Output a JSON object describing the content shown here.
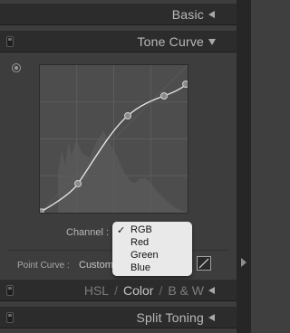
{
  "panels": {
    "basic": {
      "title": "Basic"
    },
    "tone_curve": {
      "title": "Tone Curve"
    },
    "hsl": {
      "hsl": "HSL",
      "color": "Color",
      "bw": "B & W",
      "sep": "/"
    },
    "split_toning": {
      "title": "Split Toning"
    }
  },
  "tone_curve": {
    "channel_label": "Channel :",
    "channel_options": [
      "RGB",
      "Red",
      "Green",
      "Blue"
    ],
    "selected_channel": "RGB",
    "point_curve_label": "Point Curve :",
    "point_curve_value": "Custom"
  },
  "icons": {
    "target": "target-adjustment-icon",
    "collapse": "triangle-left-icon",
    "expand": "triangle-down-icon",
    "linear_curve": "diagonal-line-icon",
    "side_panel": "arrow-right-icon"
  },
  "colors": {
    "panel_bg": "#3d3d3d",
    "header_bg": "#2c2c2c",
    "curve_bg": "#4d4d4d",
    "menu_bg": "#e9e9e9"
  }
}
